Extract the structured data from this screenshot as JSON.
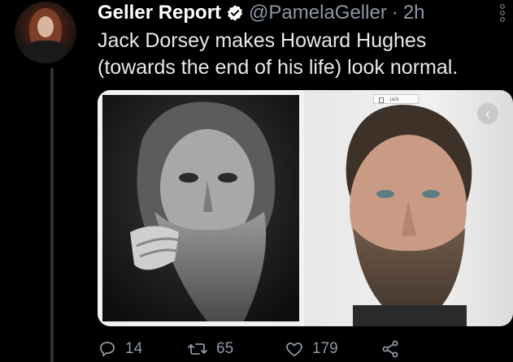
{
  "tweet": {
    "display_name": "Geller Report",
    "handle": "@PamelaGeller",
    "separator": "·",
    "time": "2h",
    "text": "Jack Dorsey makes Howard Hughes (towards the end of his life) look normal.",
    "media": {
      "left_photo": "howard-hughes-photo",
      "right_photo": "jack-dorsey-photo",
      "search_chip_text": "jack",
      "nav_arrow_icon": "chevron-left-icon"
    },
    "actions": {
      "reply_count": "14",
      "retweet_count": "65",
      "like_count": "179"
    }
  },
  "colors": {
    "background": "#000000",
    "name": "#ffffff",
    "secondary": "#8b98a5",
    "text": "#e7e9ea",
    "verified": "#ffffff"
  }
}
